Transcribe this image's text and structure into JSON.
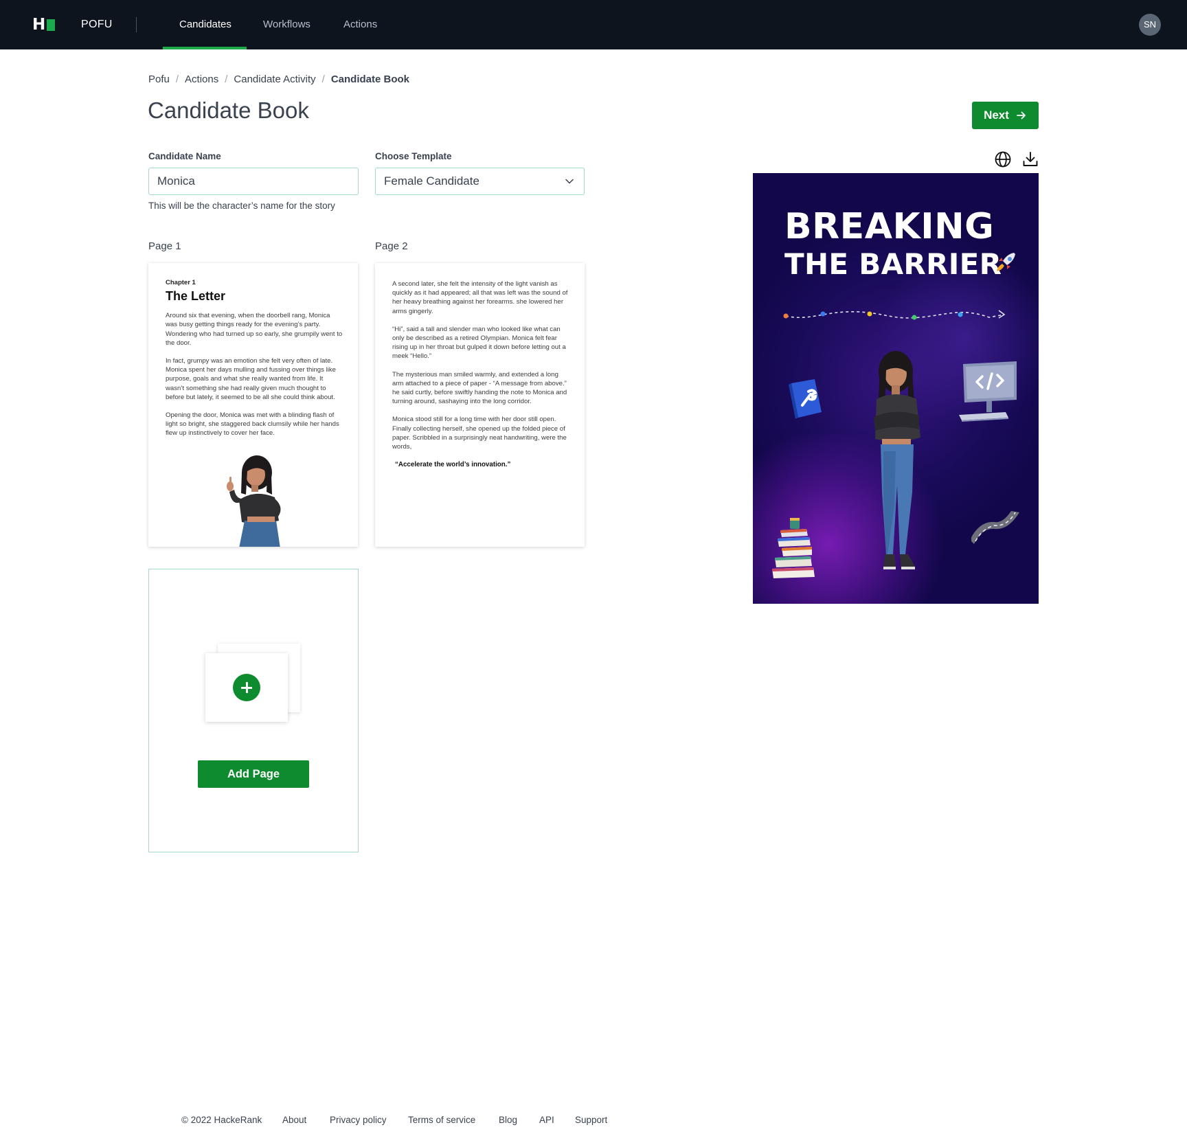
{
  "nav": {
    "brand": "POFU",
    "tabs": [
      "Candidates",
      "Workflows",
      "Actions"
    ],
    "active_tab": "Candidates",
    "avatar_initials": "SN"
  },
  "breadcrumb": [
    "Pofu",
    "Actions",
    "Candidate Activity",
    "Candidate Book"
  ],
  "page_title": "Candidate Book",
  "next_button": "Next",
  "form": {
    "candidate_name_label": "Candidate Name",
    "candidate_name_value": "Monica",
    "candidate_name_helper": "This will be the character’s name for the story",
    "template_label": "Choose Template",
    "template_value": "Female Candidate"
  },
  "pages": {
    "page1_label": "Page 1",
    "page2_label": "Page 2",
    "page1": {
      "chapter": "Chapter 1",
      "title": "The Letter",
      "paragraphs": [
        "Around six that evening, when the doorbell rang, Monica was busy getting things ready for the evening’s party. Wondering who had turned up so early, she grumpily went to the door.",
        "In fact, grumpy was an emotion she felt very often of late. Monica spent her days mulling and fussing over things like purpose, goals and what she really wanted from life. It wasn’t something she had really given much thought to before but lately, it seemed to be all she could think about.",
        "Opening the door, Monica was met with a blinding flash of light so bright, she staggered back clumsily while her hands flew up instinctively to cover her face."
      ]
    },
    "page2": {
      "paragraphs": [
        "A second later, she felt the intensity of the light vanish as quickly as it had appeared; all that was left was the sound of her heavy breathing against her forearms. she lowered her arms gingerly.",
        "“Hi”, said a tall and slender man who looked like what can only be described as a retired Olympian. Monica felt fear rising up in her throat but gulped it down before letting out a meek “Hello.”",
        "The mysterious man smiled warmly, and extended a long arm attached to a piece of paper - “A message from above.” he said curtly, before swiftly handing the note to Monica and turning around, sashaying into the long corridor.",
        "Monica stood still for a long time with her door still open. Finally collecting herself, she opened up the folded piece of paper. Scribbled in a surprisingly neat handwriting, were the words,"
      ],
      "quote": "“Accelerate the world’s innovation.”"
    },
    "add_page_button": "Add Page"
  },
  "preview": {
    "title_line1": "BREAKING",
    "title_line2": "THE BARRIER",
    "icons": [
      "globe-icon",
      "download-icon"
    ]
  },
  "footer": {
    "copyright": "© 2022 HackeRank",
    "links": [
      "About",
      "Privacy policy",
      "Terms of service",
      "Blog",
      "API",
      "Support"
    ]
  },
  "colors": {
    "nav_bg": "#0e141e",
    "accent_green": "#0e8a2f",
    "nav_underline": "#1ba94c",
    "input_border": "#a3d9c6",
    "cover_bg": "#12074a"
  }
}
